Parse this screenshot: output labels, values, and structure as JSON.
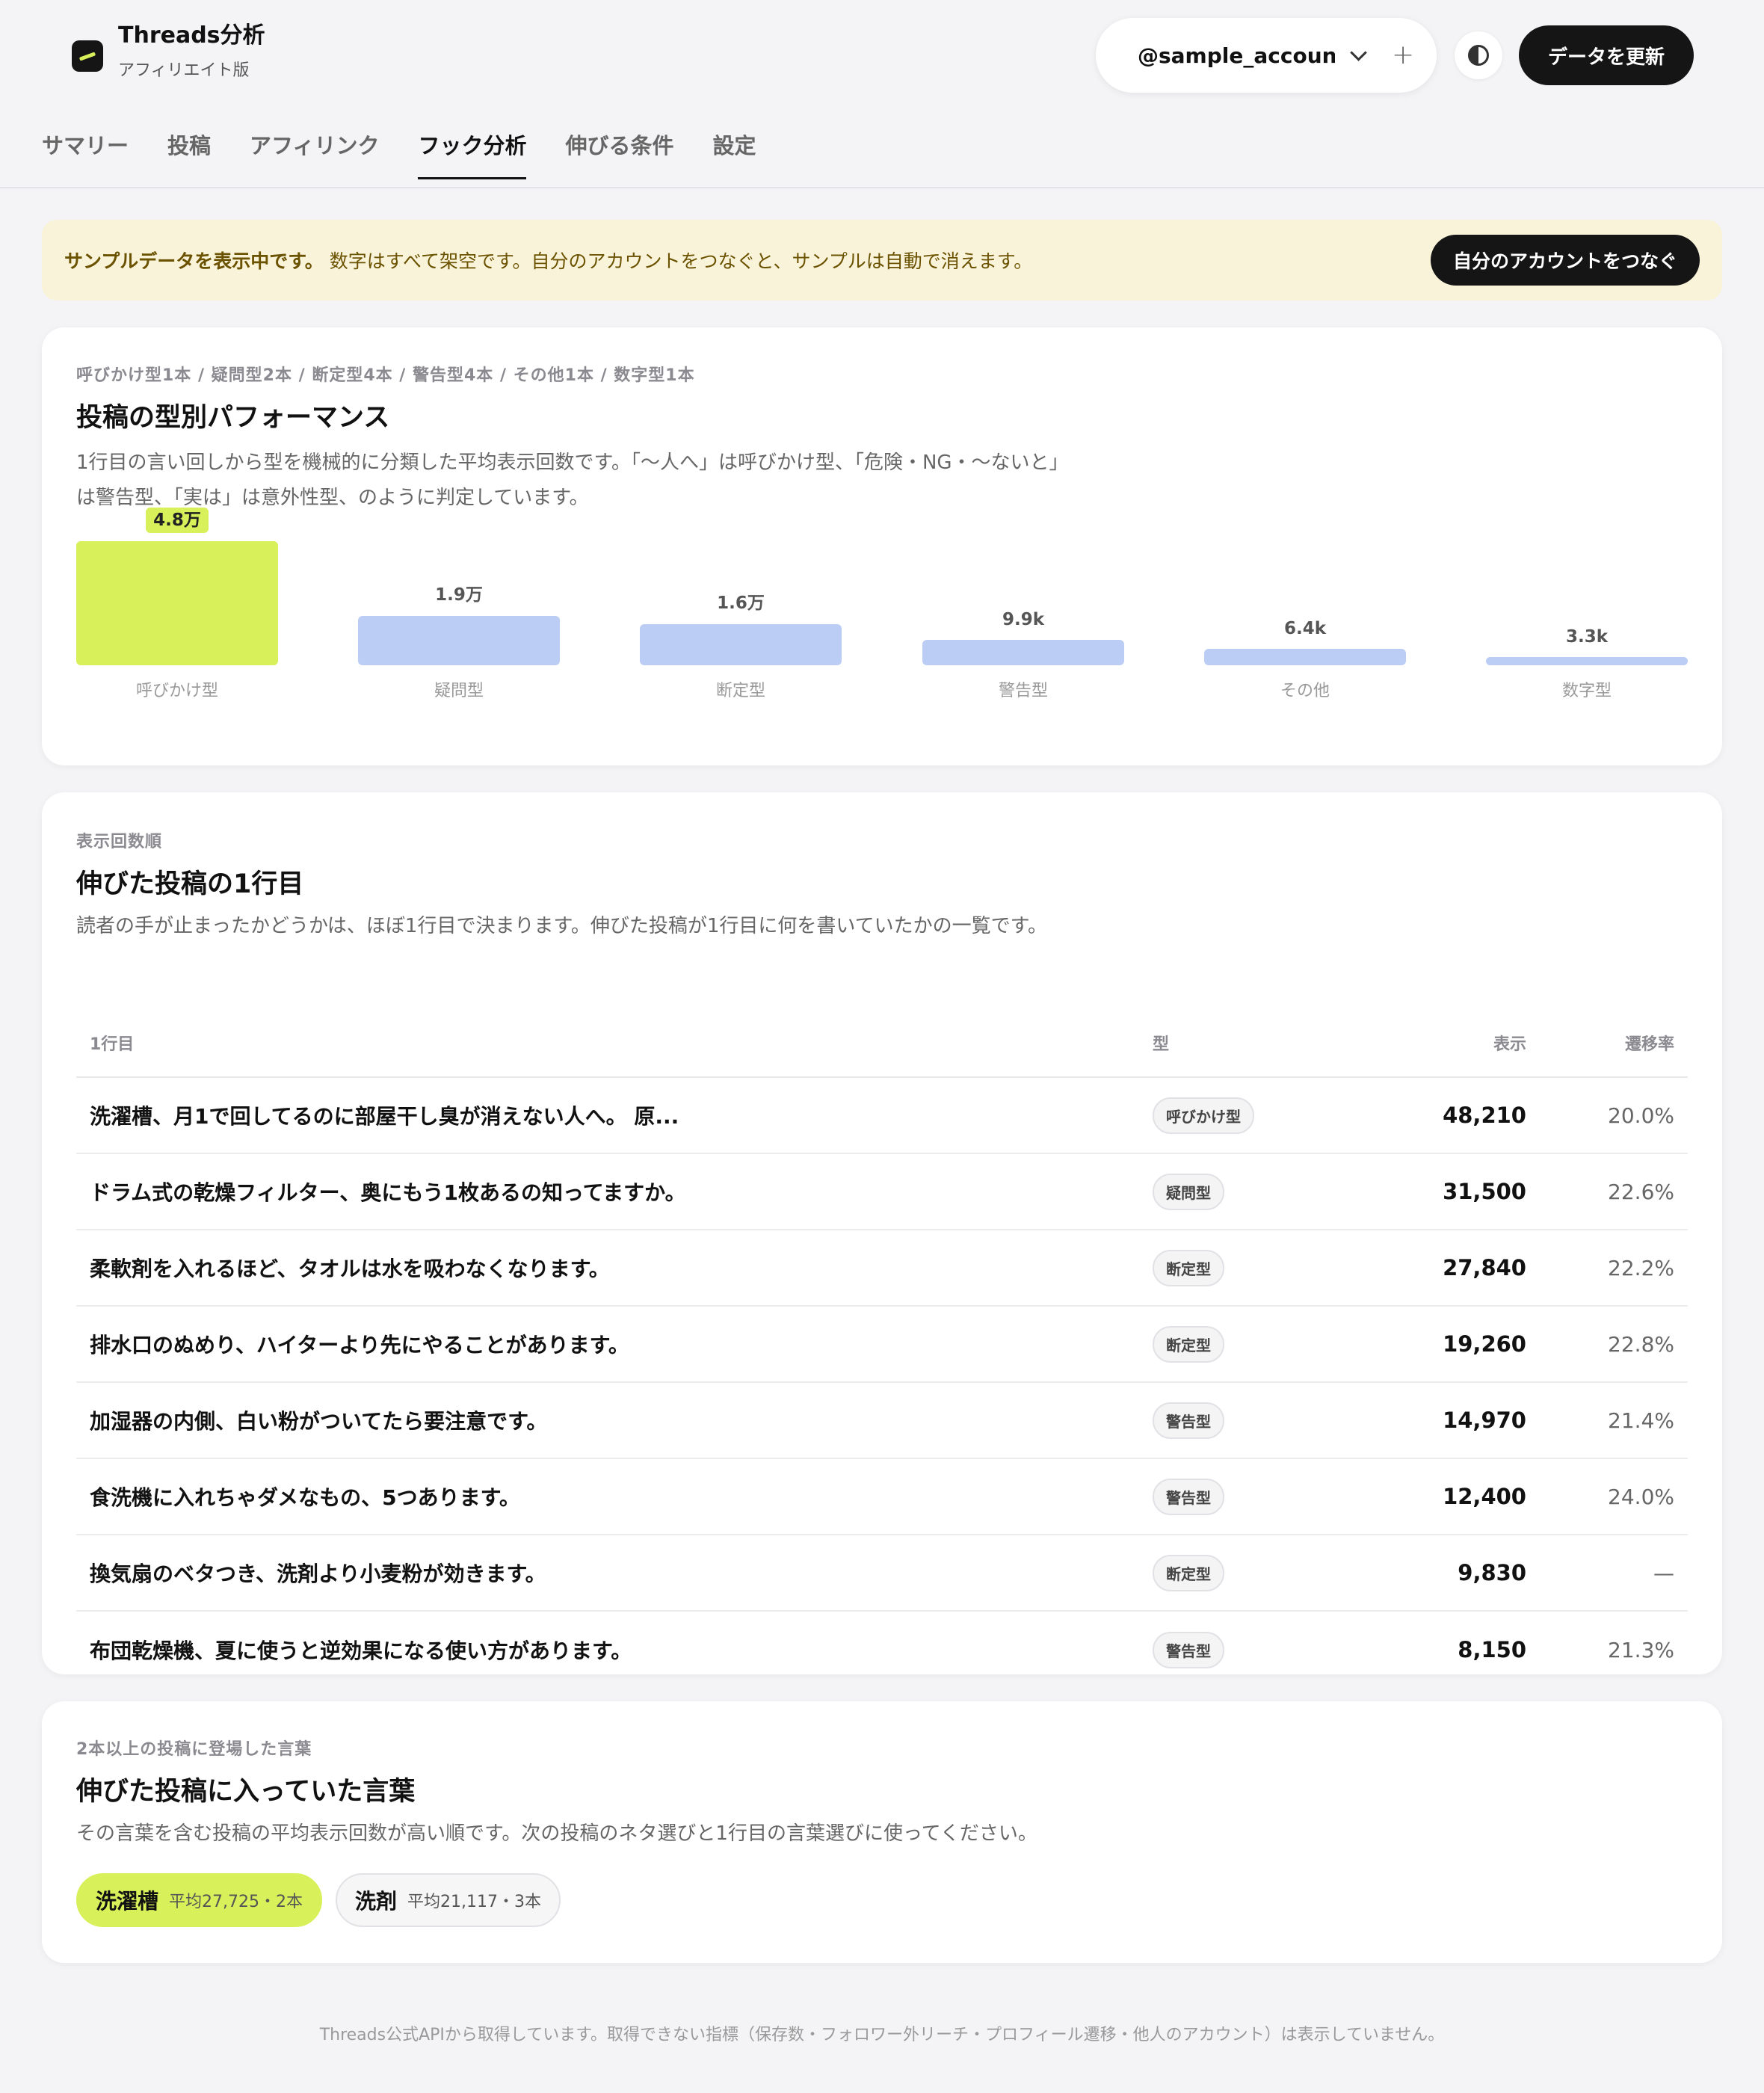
{
  "app": {
    "title": "Threads分析",
    "subtitle": "アフィリエイト版"
  },
  "header": {
    "account": "@sample_account",
    "add_label": "+",
    "refresh_label": "データを更新"
  },
  "tabs": [
    {
      "label": "サマリー",
      "active": false
    },
    {
      "label": "投稿",
      "active": false
    },
    {
      "label": "アフィリンク",
      "active": false
    },
    {
      "label": "フック分析",
      "active": true
    },
    {
      "label": "伸びる条件",
      "active": false
    },
    {
      "label": "設定",
      "active": false
    }
  ],
  "notice": {
    "strong": "サンプルデータを表示中です。",
    "text": "数字はすべて架空です。自分のアカウントをつなぐと、サンプルは自動で消えます。",
    "button": "自分のアカウントをつなぐ"
  },
  "performance": {
    "eyebrow": "呼びかけ型1本 / 疑問型2本 / 断定型4本 / 警告型4本 / その他1本 / 数字型1本",
    "title": "投稿の型別パフォーマンス",
    "desc_line1": "1行目の言い回しから型を機械的に分類した平均表示回数です。「〜人へ」は呼びかけ型、「危険・NG・〜ないと」",
    "desc_line2": "は警告型、「実は」は意外性型、のように判定しています。"
  },
  "chart_data": {
    "type": "bar",
    "categories": [
      "呼びかけ型",
      "疑問型",
      "断定型",
      "警告型",
      "その他",
      "数字型"
    ],
    "values": [
      48000,
      19000,
      16000,
      9900,
      6400,
      3300
    ],
    "value_labels": [
      "4.8万",
      "1.9万",
      "1.6万",
      "9.9k",
      "6.4k",
      "3.3k"
    ],
    "highlight_index": 0,
    "colors": {
      "highlight": "#d8f059",
      "default": "#bccdf5"
    }
  },
  "top_posts": {
    "eyebrow": "表示回数順",
    "title": "伸びた投稿の1行目",
    "desc": "読者の手が止まったかどうかは、ほぼ1行目で決まります。伸びた投稿が1行目に何を書いていたかの一覧です。",
    "columns": [
      "1行目",
      "型",
      "表示",
      "遷移率"
    ],
    "rows": [
      {
        "hook": "洗濯槽、月1で回してるのに部屋干し臭が消えない人へ。 原...",
        "type": "呼びかけ型",
        "views": "48,210",
        "rate": "20.0%"
      },
      {
        "hook": "ドラム式の乾燥フィルター、奥にもう1枚あるの知ってますか。",
        "type": "疑問型",
        "views": "31,500",
        "rate": "22.6%"
      },
      {
        "hook": "柔軟剤を入れるほど、タオルは水を吸わなくなります。",
        "type": "断定型",
        "views": "27,840",
        "rate": "22.2%"
      },
      {
        "hook": "排水口のぬめり、ハイターより先にやることがあります。",
        "type": "断定型",
        "views": "19,260",
        "rate": "22.8%"
      },
      {
        "hook": "加湿器の内側、白い粉がついてたら要注意です。",
        "type": "警告型",
        "views": "14,970",
        "rate": "21.4%"
      },
      {
        "hook": "食洗機に入れちゃダメなもの、5つあります。",
        "type": "警告型",
        "views": "12,400",
        "rate": "24.0%"
      },
      {
        "hook": "換気扇のベタつき、洗剤より小麦粉が効きます。",
        "type": "断定型",
        "views": "9,830",
        "rate": "—"
      },
      {
        "hook": "布団乾燥機、夏に使うと逆効果になる使い方があります。",
        "type": "警告型",
        "views": "8,150",
        "rate": "21.3%"
      }
    ]
  },
  "keywords": {
    "eyebrow": "2本以上の投稿に登場した言葉",
    "title": "伸びた投稿に入っていた言葉",
    "desc": "その言葉を含む投稿の平均表示回数が高い順です。次の投稿のネタ選びと1行目の言葉選びに使ってください。",
    "items": [
      {
        "word": "洗濯槽",
        "meta": "平均27,725・2本",
        "highlight": true
      },
      {
        "word": "洗剤",
        "meta": "平均21,117・3本",
        "highlight": false
      }
    ]
  },
  "footer": "Threads公式APIから取得しています。取得できない指標（保存数・フォロワー外リーチ・プロフィール遷移・他人のアカウント）は表示していません。"
}
